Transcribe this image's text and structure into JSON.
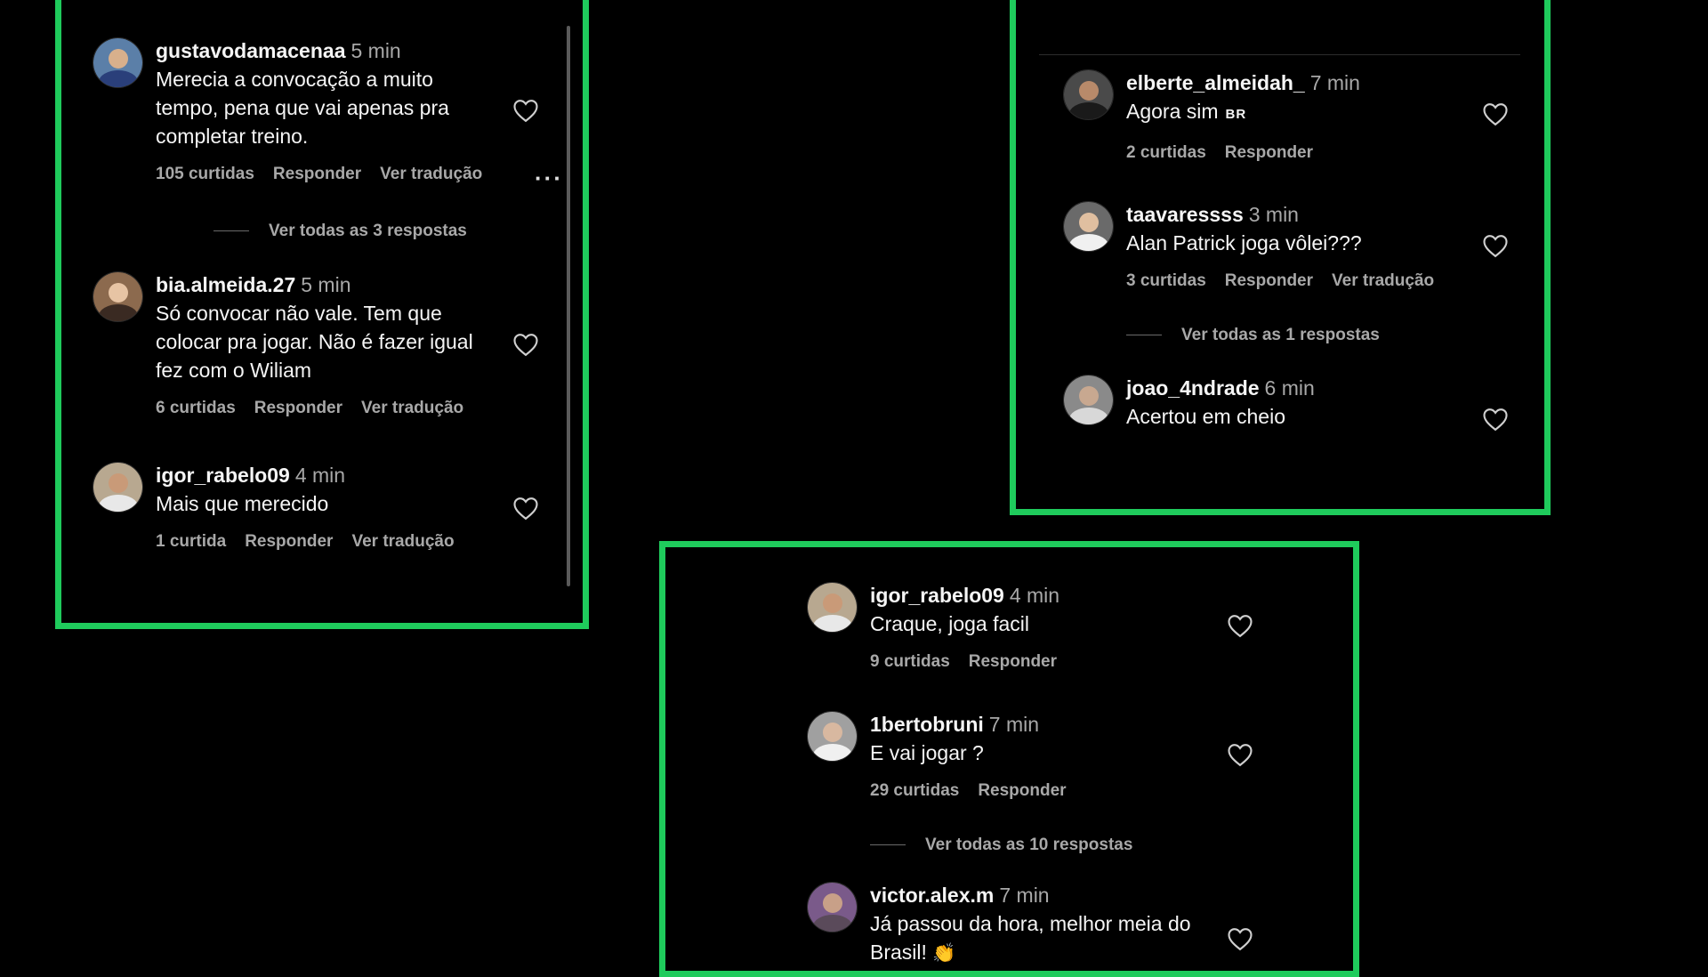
{
  "panels": {
    "left": {
      "comments": [
        {
          "user": "gustavodamacenaa",
          "time": "5 min",
          "text": [
            "Merecia a convocação a muito",
            "tempo, pena que vai apenas pra",
            "completar treino."
          ],
          "likes": "105 curtidas",
          "reply": "Responder",
          "translate": "Ver tradução",
          "more": "···",
          "view_replies": "Ver todas as 3 respostas"
        },
        {
          "user": "bia.almeida.27",
          "time": "5 min",
          "text": [
            "Só convocar não vale. Tem que",
            "colocar pra jogar. Não é fazer igual",
            "fez com o Wiliam"
          ],
          "likes": "6 curtidas",
          "reply": "Responder",
          "translate": "Ver tradução"
        },
        {
          "user": "igor_rabelo09",
          "time": "4 min",
          "text": [
            "Mais que merecido"
          ],
          "likes": "1 curtida",
          "reply": "Responder",
          "translate": "Ver tradução"
        }
      ]
    },
    "right": {
      "comments": [
        {
          "user": "elberte_almeidah_",
          "time": "7 min",
          "text": "Agora sim",
          "flag": "BR",
          "likes": "2 curtidas",
          "reply": "Responder"
        },
        {
          "user": "taavaressss",
          "time": "3 min",
          "text": "Alan Patrick joga vôlei???",
          "likes": "3 curtidas",
          "reply": "Responder",
          "translate": "Ver tradução",
          "view_replies": "Ver todas as 1 respostas"
        },
        {
          "user": "joao_4ndrade",
          "time": "6 min",
          "text": "Acertou em cheio"
        }
      ]
    },
    "bottom": {
      "comments": [
        {
          "user": "igor_rabelo09",
          "time": "4 min",
          "text": "Craque, joga facil",
          "likes": "9 curtidas",
          "reply": "Responder"
        },
        {
          "user": "1bertobruni",
          "time": "7 min",
          "text": "E vai jogar ?",
          "likes": "29 curtidas",
          "reply": "Responder",
          "view_replies": "Ver todas as 10 respostas"
        },
        {
          "user": "victor.alex.m",
          "time": "7 min",
          "text": [
            "Já passou da hora, melhor meia do",
            "Brasil!"
          ],
          "emoji": "👏"
        }
      ]
    }
  },
  "colors": {
    "frame": "#1fcb5c",
    "background": "#000000",
    "text": "#f5f5f5",
    "muted": "#a8a8a8"
  },
  "icons": {
    "like": "heart-outline-icon",
    "more": "more-options-icon",
    "avatar": "user-avatar"
  }
}
